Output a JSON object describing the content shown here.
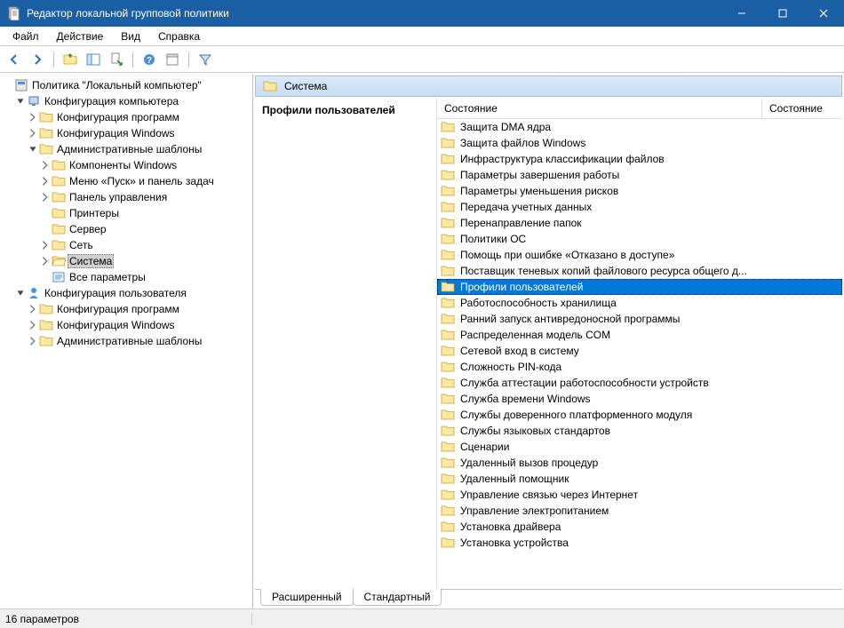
{
  "window": {
    "title": "Редактор локальной групповой политики"
  },
  "menu": {
    "file": "Файл",
    "action": "Действие",
    "view": "Вид",
    "help": "Справка"
  },
  "content": {
    "breadcrumb": "Система",
    "selected_label": "Профили пользователей",
    "column_main": "Состояние",
    "column_state": "Состояние"
  },
  "tabs": {
    "extended": "Расширенный",
    "standard": "Стандартный"
  },
  "status": {
    "text": "16 параметров"
  },
  "tree": {
    "root": "Политика \"Локальный компьютер\"",
    "computer_config": "Конфигурация компьютера",
    "software_settings": "Конфигурация программ",
    "windows_settings": "Конфигурация Windows",
    "admin_templates": "Административные шаблоны",
    "win_components": "Компоненты Windows",
    "start_taskbar": "Меню «Пуск» и панель задач",
    "control_panel": "Панель управления",
    "printers": "Принтеры",
    "server": "Сервер",
    "network": "Сеть",
    "system": "Система",
    "all_settings": "Все параметры",
    "user_config": "Конфигурация пользователя",
    "u_software": "Конфигурация программ",
    "u_windows": "Конфигурация Windows",
    "u_admin": "Административные шаблоны"
  },
  "items": [
    {
      "label": "Защита DMA ядра"
    },
    {
      "label": "Защита файлов Windows"
    },
    {
      "label": "Инфраструктура классификации файлов"
    },
    {
      "label": "Параметры завершения работы"
    },
    {
      "label": "Параметры уменьшения рисков"
    },
    {
      "label": "Передача учетных данных"
    },
    {
      "label": "Перенаправление папок"
    },
    {
      "label": "Политики ОС"
    },
    {
      "label": "Помощь при ошибке «Отказано в доступе»"
    },
    {
      "label": "Поставщик теневых копий файлового ресурса общего д..."
    },
    {
      "label": "Профили пользователей",
      "selected": true
    },
    {
      "label": "Работоспособность хранилища"
    },
    {
      "label": "Ранний запуск антивредоносной программы"
    },
    {
      "label": "Распределенная модель COM"
    },
    {
      "label": "Сетевой вход в систему"
    },
    {
      "label": "Сложность PIN-кода"
    },
    {
      "label": "Служба аттестации работоспособности устройств"
    },
    {
      "label": "Служба времени Windows"
    },
    {
      "label": "Службы доверенного платформенного модуля"
    },
    {
      "label": "Службы языковых стандартов"
    },
    {
      "label": "Сценарии"
    },
    {
      "label": "Удаленный вызов процедур"
    },
    {
      "label": "Удаленный помощник"
    },
    {
      "label": "Управление связью через Интернет"
    },
    {
      "label": "Управление электропитанием"
    },
    {
      "label": "Установка драйвера"
    },
    {
      "label": "Установка устройства"
    }
  ]
}
